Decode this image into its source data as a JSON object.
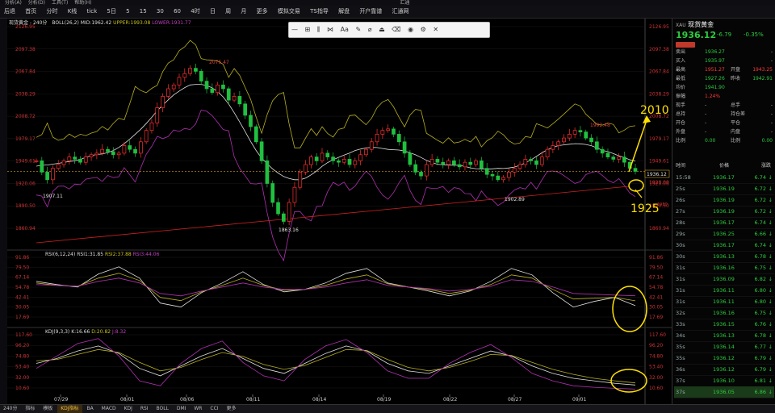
{
  "menubar": {
    "items": [
      "分析(A)",
      "分析(D)",
      "工具(T)",
      "帮助(H)"
    ],
    "title": "汇通"
  },
  "toolbar": {
    "items": [
      "后退",
      "首页",
      "分时",
      "K线",
      "tick",
      "5日",
      "5",
      "15",
      "30",
      "60",
      "4时",
      "日",
      "周",
      "月",
      "更多",
      "模拟交易",
      "TS指导",
      "解盘",
      "开户靠谱",
      "汇通网"
    ]
  },
  "drawtools": [
    "—",
    "⊞",
    "⫼",
    "⋈",
    "Aa",
    "✎",
    "⌀",
    "⏏",
    "⌫",
    "◉",
    "⚙",
    "✕"
  ],
  "chart": {
    "label": "现货黄金 - 240分",
    "boll_label": "BOLL(26,2)",
    "mid": "MID:1962.42",
    "upper": "UPPER:1993.08",
    "lower": "LOWER:1931.77",
    "rsi_label": "RSI(6,12,24)",
    "rsi1": "RSI1:31.85",
    "rsi2": "RSI2:37.88",
    "rsi3": "RSI3:44.06",
    "kdj_label": "KDJ(9,3,3)",
    "k": "K:16.66",
    "d": "D:20.82",
    "j": "J:8.32",
    "price_ticks": [
      "2126.95",
      "2097.38",
      "2067.84",
      "2038.29",
      "2008.72",
      "1979.17",
      "1949.61",
      "1920.06",
      "1890.50",
      "1860.94"
    ],
    "rsi_ticks": [
      "91.86",
      "79.50",
      "67.14",
      "54.78",
      "42.41",
      "30.05",
      "17.69"
    ],
    "kdj_ticks": [
      "117.60",
      "96.20",
      "74.80",
      "53.40",
      "32.00",
      "10.60"
    ],
    "dates": [
      "07/29",
      "08/01",
      "08/06",
      "08/11",
      "08/14",
      "08/19",
      "08/22",
      "08/27",
      "09/01"
    ],
    "annotations": {
      "high1": "2075.47",
      "low1": "1907.11",
      "low2": "1863.16",
      "high2": "1992.48",
      "low3": "1902.89",
      "current": "1936.12",
      "target_up": "2010",
      "target_down": "1925",
      "time": "15:58",
      "r1920": "1920.00",
      "r1950": "1950"
    },
    "colors": {
      "up": "#ff3030",
      "down": "#20c040",
      "boll_upper": "#b8b020",
      "boll_mid": "#e0e0e0",
      "boll_lower": "#b030b0",
      "annot": "#ffe000"
    }
  },
  "chart_data": {
    "type": "line",
    "series": [
      {
        "name": "RSI1",
        "values": [
          62,
          58,
          55,
          71,
          80,
          66,
          35,
          30,
          48,
          60,
          74,
          58,
          49,
          52,
          60,
          72,
          78,
          60,
          55,
          50,
          44,
          50,
          62,
          78,
          70,
          48,
          30,
          37,
          42,
          31.85
        ]
      },
      {
        "name": "RSI2",
        "values": [
          60,
          57,
          56,
          66,
          72,
          63,
          42,
          38,
          49,
          57,
          66,
          57,
          51,
          52,
          57,
          65,
          70,
          59,
          55,
          52,
          47,
          51,
          58,
          70,
          66,
          52,
          40,
          41,
          42,
          37.88
        ]
      },
      {
        "name": "RSI3",
        "values": [
          58,
          57,
          56,
          62,
          66,
          60,
          47,
          44,
          50,
          55,
          60,
          55,
          52,
          52,
          55,
          60,
          64,
          57,
          55,
          53,
          50,
          52,
          56,
          64,
          62,
          55,
          47,
          46,
          45,
          44.06
        ]
      }
    ]
  },
  "quote": {
    "symbol": "XAU",
    "name": "现货黄金",
    "price": "1936.12",
    "change": "-6.79",
    "pct": "-0.35%",
    "rows": [
      {
        "l": "卖出",
        "v": "1936.27",
        "l2": "",
        "v2": "-"
      },
      {
        "l": "买入",
        "v": "1935.97",
        "l2": "",
        "v2": "-"
      },
      {
        "l": "最高",
        "v": "1951.27",
        "l2": "开盘",
        "v2": "1943.25"
      },
      {
        "l": "最低",
        "v": "1927.26",
        "l2": "昨收",
        "v2": "1942.91"
      },
      {
        "l": "均价",
        "v": "1941.90",
        "l2": "",
        "v2": ""
      },
      {
        "l": "振幅",
        "v": "1.24%",
        "l2": "",
        "v2": ""
      },
      {
        "l": "现手",
        "v": "-",
        "l2": "总手",
        "v2": "-"
      },
      {
        "l": "总持",
        "v": "-",
        "l2": "持仓差",
        "v2": "-"
      },
      {
        "l": "开仓",
        "v": "-",
        "l2": "平仓",
        "v2": "-"
      },
      {
        "l": "外盘",
        "v": "-",
        "l2": "内盘",
        "v2": "-"
      },
      {
        "l": "比例",
        "v": "0.00",
        "l2": "比例",
        "v2": "0.00"
      }
    ],
    "tick_header": {
      "time": "时间",
      "price": "价格",
      "chg": "涨跌"
    },
    "ticks": [
      {
        "t": "15:58",
        "p": "1936.17",
        "c": "6.74"
      },
      {
        "t": "25s",
        "p": "1936.19",
        "c": "6.72"
      },
      {
        "t": "26s",
        "p": "1936.19",
        "c": "6.72"
      },
      {
        "t": "27s",
        "p": "1936.19",
        "c": "6.72"
      },
      {
        "t": "28s",
        "p": "1936.17",
        "c": "6.74"
      },
      {
        "t": "29s",
        "p": "1936.25",
        "c": "6.66"
      },
      {
        "t": "30s",
        "p": "1936.17",
        "c": "6.74"
      },
      {
        "t": "30s",
        "p": "1936.13",
        "c": "6.78"
      },
      {
        "t": "31s",
        "p": "1936.16",
        "c": "6.75"
      },
      {
        "t": "31s",
        "p": "1936.09",
        "c": "6.82"
      },
      {
        "t": "31s",
        "p": "1936.11",
        "c": "6.80"
      },
      {
        "t": "31s",
        "p": "1936.11",
        "c": "6.80"
      },
      {
        "t": "32s",
        "p": "1936.16",
        "c": "6.75"
      },
      {
        "t": "33s",
        "p": "1936.15",
        "c": "6.76"
      },
      {
        "t": "34s",
        "p": "1936.13",
        "c": "6.78"
      },
      {
        "t": "35s",
        "p": "1936.14",
        "c": "6.77"
      },
      {
        "t": "35s",
        "p": "1936.12",
        "c": "6.79"
      },
      {
        "t": "36s",
        "p": "1936.12",
        "c": "6.79"
      },
      {
        "t": "37s",
        "p": "1936.10",
        "c": "6.81"
      },
      {
        "t": "37s",
        "p": "1936.05",
        "c": "6.86"
      }
    ]
  },
  "statusbar": {
    "items": [
      "240分",
      "指标",
      "模板",
      "KDJ指标",
      "BA",
      "MACD",
      "KDJ",
      "RSI",
      "BOLL",
      "DMI",
      "WR",
      "CCI",
      "更多"
    ],
    "active": "KDJ指标"
  }
}
